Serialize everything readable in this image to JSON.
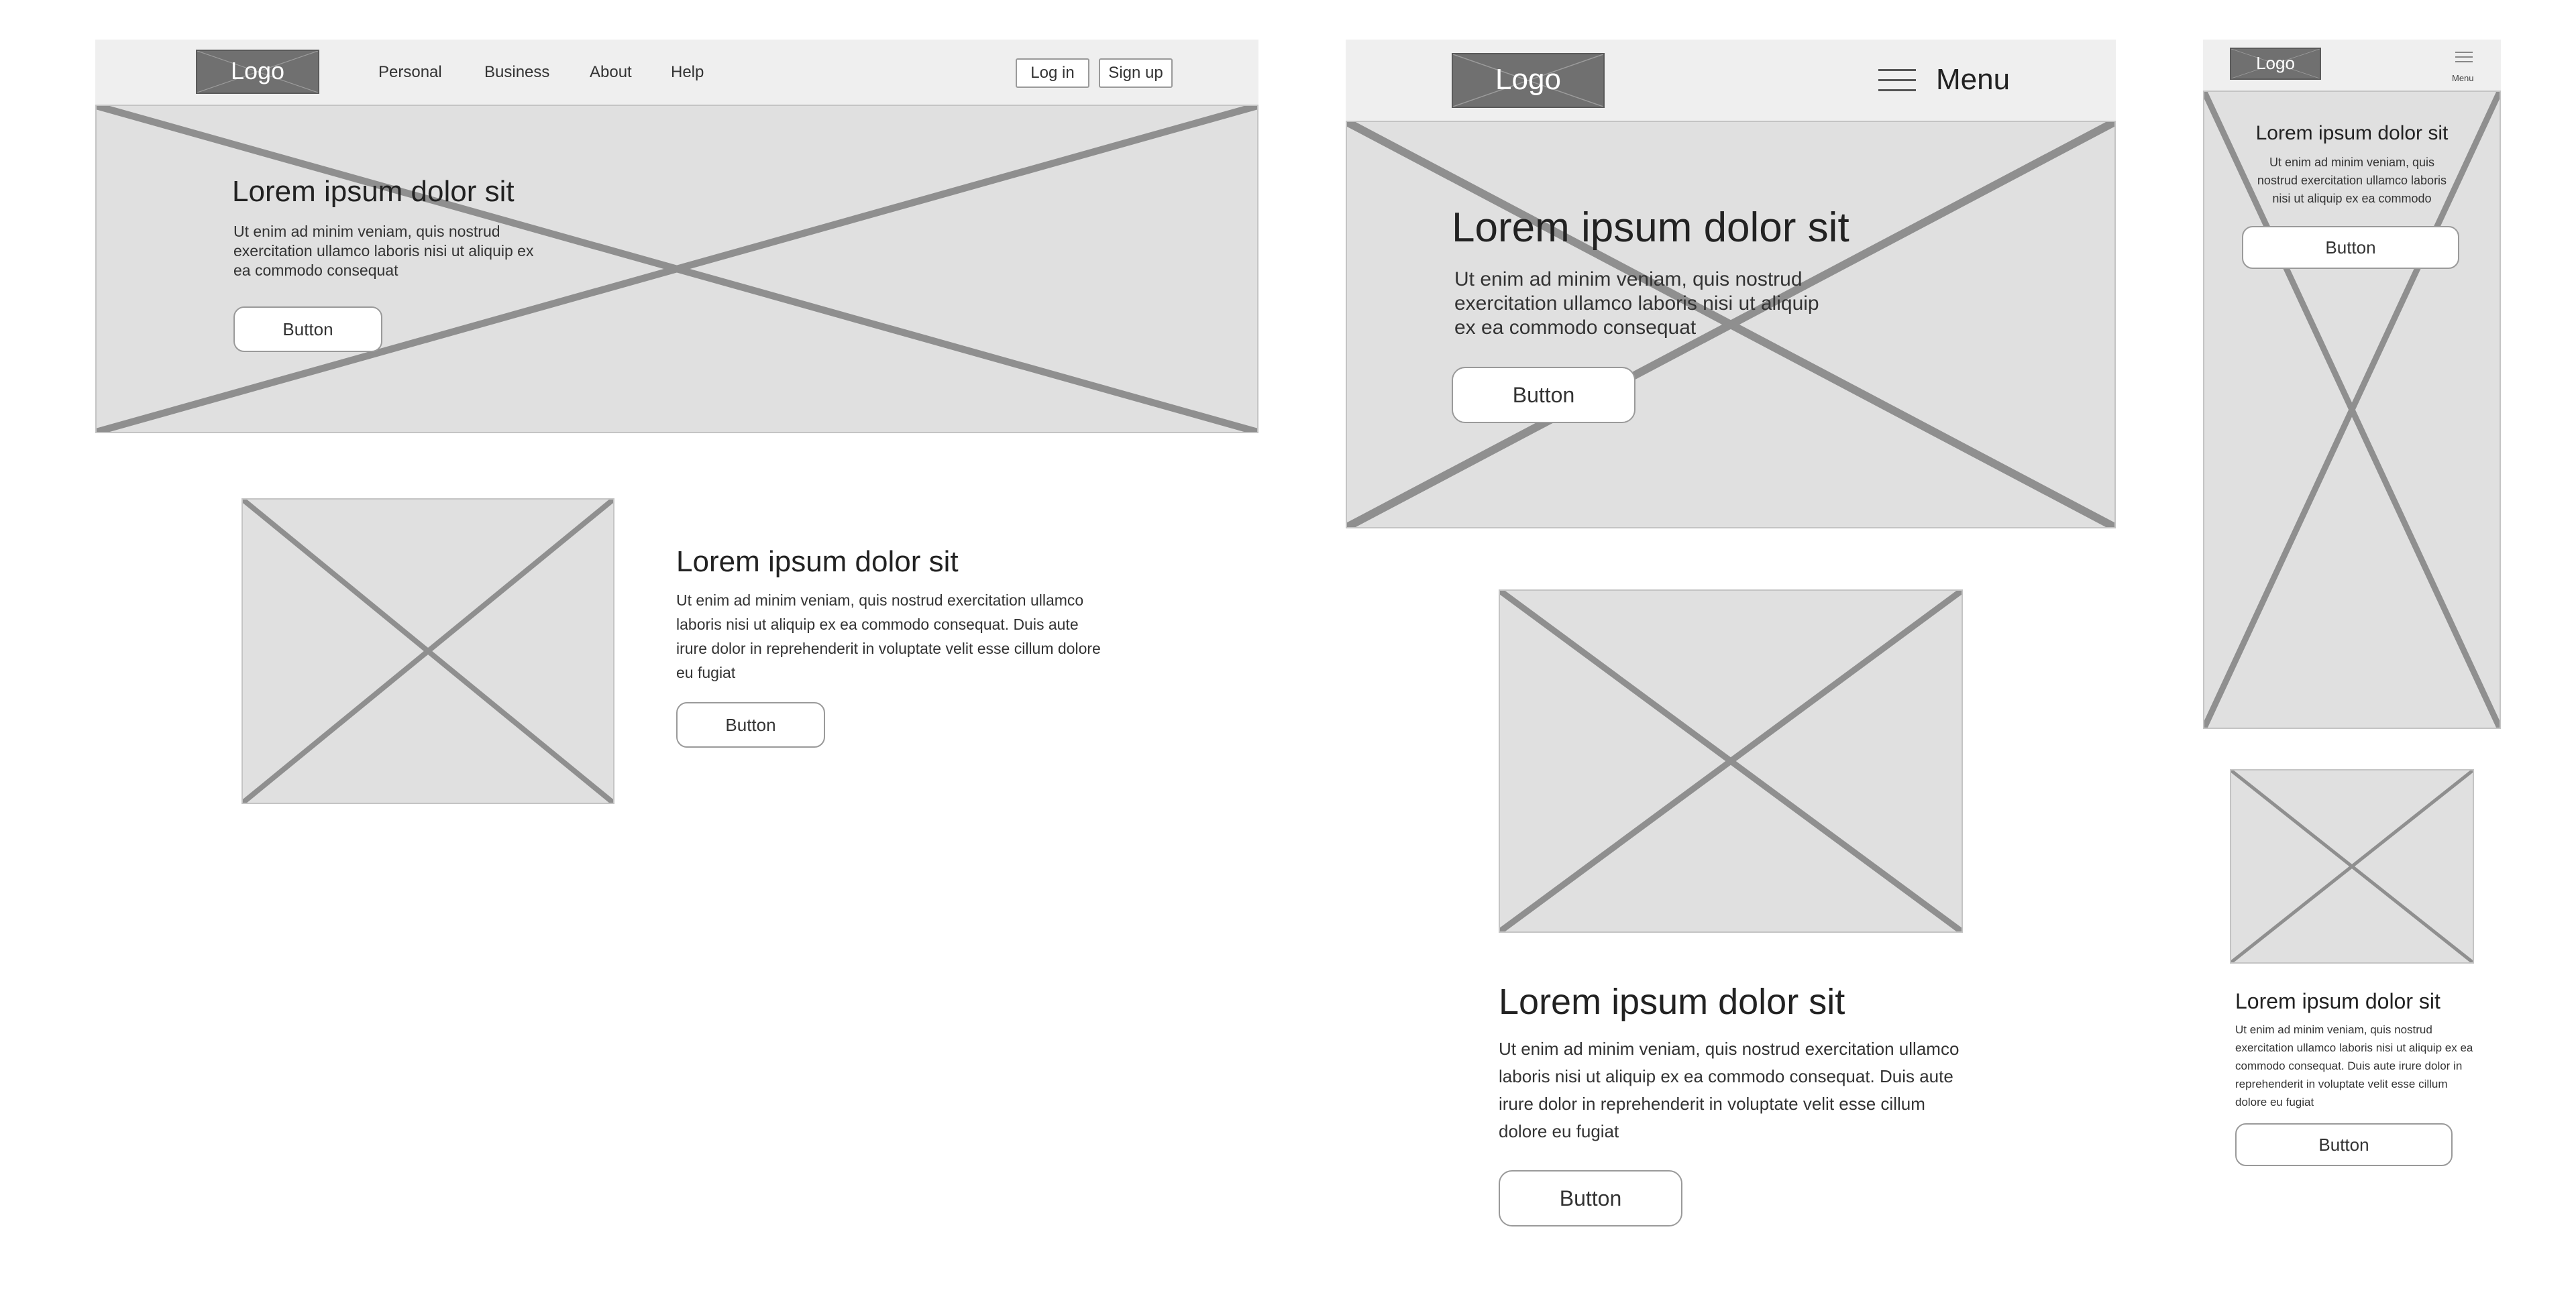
{
  "desktop": {
    "nav": {
      "logo": "Logo",
      "links": [
        "Personal",
        "Business",
        "About",
        "Help"
      ],
      "login_label": "Log in",
      "signup_label": "Sign up"
    },
    "hero": {
      "title": "Lorem ipsum dolor sit",
      "text": "Ut enim ad minim veniam, quis nostrud exercitation ullamco laboris nisi ut aliquip ex ea commodo consequat",
      "button_label": "Button"
    },
    "feature": {
      "title": "Lorem ipsum dolor sit",
      "text": "Ut enim ad minim veniam, quis nostrud exercitation ullamco laboris nisi ut aliquip ex ea commodo consequat. Duis aute irure dolor in reprehenderit in voluptate velit esse cillum dolore eu fugiat",
      "button_label": "Button"
    }
  },
  "tablet": {
    "nav": {
      "logo": "Logo",
      "menu_label": "Menu"
    },
    "hero": {
      "title": "Lorem ipsum dolor sit",
      "text": "Ut enim ad minim veniam, quis nostrud exercitation ullamco laboris nisi ut aliquip ex ea commodo consequat",
      "button_label": "Button"
    },
    "feature": {
      "title": "Lorem ipsum dolor sit",
      "text": "Ut enim ad minim veniam, quis nostrud exercitation ullamco laboris nisi ut aliquip ex ea commodo consequat. Duis aute irure dolor in reprehenderit in voluptate velit esse cillum dolore eu fugiat",
      "button_label": "Button"
    }
  },
  "mobile": {
    "nav": {
      "logo": "Logo",
      "menu_label": "Menu"
    },
    "hero": {
      "title": "Lorem ipsum dolor sit",
      "text": "Ut enim ad minim veniam, quis nostrud exercitation ullamco laboris nisi ut aliquip ex ea commodo",
      "button_label": "Button"
    },
    "feature": {
      "title": "Lorem ipsum dolor sit",
      "text": "Ut enim ad minim veniam, quis nostrud exercitation ullamco laboris nisi ut aliquip ex ea commodo consequat. Duis aute irure dolor in reprehenderit in voluptate velit esse cillum dolore eu fugiat",
      "button_label": "Button"
    }
  },
  "colors": {
    "nav_background": "#efefef",
    "placeholder_fill": "#e0e0e0",
    "placeholder_cross": "#8f8f8f",
    "logo_fill": "#707070"
  }
}
